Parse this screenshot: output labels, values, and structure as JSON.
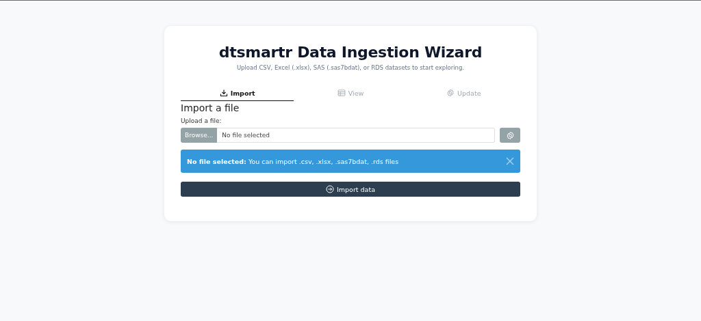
{
  "title": "dtsmartr Data Ingestion Wizard",
  "subtitle": "Upload CSV, Excel (.xlsx), SAS (.sas7bdat), or RDS datasets to start exploring.",
  "tabs": [
    {
      "label": "Import",
      "kind": "import",
      "selected": true
    },
    {
      "label": "View",
      "kind": "view",
      "selected": false
    },
    {
      "label": "Update",
      "kind": "update",
      "selected": false
    }
  ],
  "section_title": "Import a file",
  "upload": {
    "label": "Upload a file:",
    "button": "Browse...",
    "placeholder": "No file selected"
  },
  "alert": {
    "message": "**No file selected:** You can import .csv, .xlsx, .sas7bdat, .rds files"
  },
  "submit": "Import data"
}
